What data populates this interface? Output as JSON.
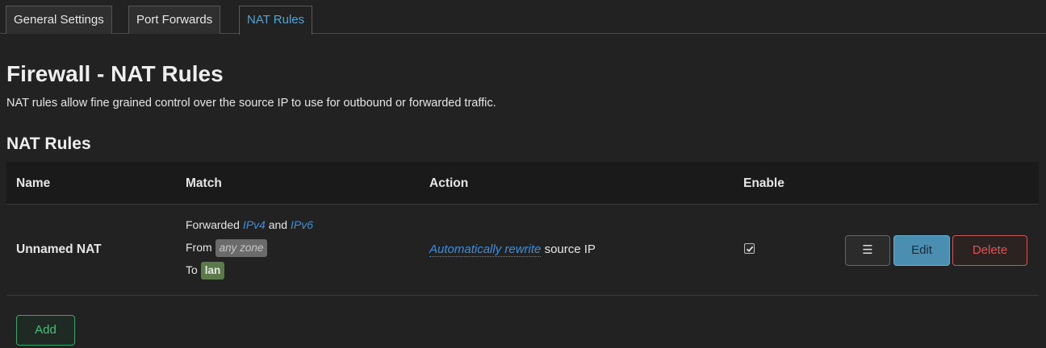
{
  "tabs": [
    {
      "label": "General Settings",
      "active": false
    },
    {
      "label": "Port Forwards",
      "active": false
    },
    {
      "label": "NAT Rules",
      "active": true
    }
  ],
  "page": {
    "title": "Firewall - NAT Rules",
    "description": "NAT rules allow fine grained control over the source IP to use for outbound or forwarded traffic."
  },
  "section": {
    "title": "NAT Rules"
  },
  "table": {
    "headers": {
      "name": "Name",
      "match": "Match",
      "action": "Action",
      "enable": "Enable"
    },
    "rows": [
      {
        "name": "Unnamed NAT",
        "match": {
          "prefix": "Forwarded",
          "ipv4": "IPv4",
          "and": "and",
          "ipv6": "IPv6",
          "from_label": "From",
          "from_zone": "any zone",
          "to_label": "To",
          "to_zone": "lan"
        },
        "action": {
          "link": "Automatically rewrite",
          "suffix": "source IP"
        },
        "enabled": true,
        "buttons": {
          "menu_icon": "☰",
          "edit": "Edit",
          "delete": "Delete"
        }
      }
    ]
  },
  "add_button": "Add",
  "colors": {
    "background": "#222222",
    "accent_tab": "#4ea5d9",
    "link": "#3b8fe0",
    "edit_button": "#4a8fb2",
    "delete_border": "#c85a5a",
    "add_border": "#37a46a",
    "zone_any": "#6b6b6b",
    "zone_lan": "#5a7a4a"
  },
  "icons": {
    "menu": "hamburger-icon",
    "checkbox": "check-icon"
  }
}
